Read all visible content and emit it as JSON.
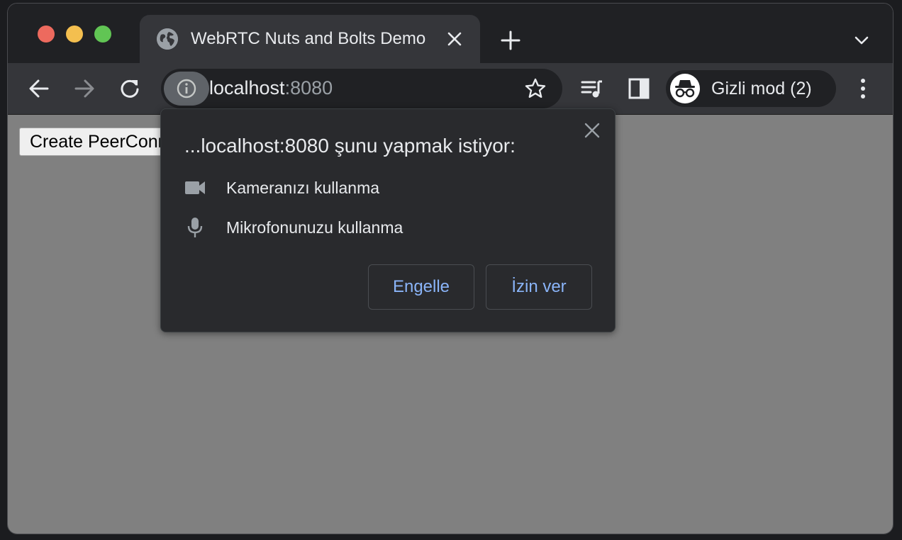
{
  "window": {
    "traffic_lights": [
      "close",
      "minimize",
      "zoom"
    ]
  },
  "tab": {
    "title": "WebRTC Nuts and Bolts Demo",
    "favicon": "globe-icon",
    "close_icon": "close-icon"
  },
  "tabstrip": {
    "new_tab_icon": "plus-icon",
    "tab_search_icon": "chevron-down-icon"
  },
  "toolbar": {
    "back_icon": "arrow-left-icon",
    "forward_icon": "arrow-right-icon",
    "reload_icon": "reload-icon",
    "media_icon": "media-queue-icon",
    "side_panel_icon": "side-panel-icon",
    "menu_icon": "kebab-menu-icon"
  },
  "omnibox": {
    "site_info_icon": "info-icon",
    "host": "localhost",
    "port": ":8080",
    "bookmark_icon": "star-icon"
  },
  "profile": {
    "avatar_icon": "incognito-icon",
    "label": "Gizli mod (2)"
  },
  "page": {
    "button_label": "Create PeerConnection"
  },
  "permission_dialog": {
    "title": "...localhost:8080 şunu yapmak istiyor:",
    "permissions": [
      {
        "icon": "camera-icon",
        "label": "Kameranızı kullanma"
      },
      {
        "icon": "microphone-icon",
        "label": "Mikrofonunuzu kullanma"
      }
    ],
    "block_label": "Engelle",
    "allow_label": "İzin ver"
  },
  "colors": {
    "window_bg": "#202124",
    "toolbar_bg": "#35363a",
    "page_bg": "#808080",
    "dialog_bg": "#292a2d",
    "accent": "#8ab4f8",
    "traffic_red": "#ed6a5e",
    "traffic_yellow": "#f4bf4f",
    "traffic_green": "#61c554"
  }
}
